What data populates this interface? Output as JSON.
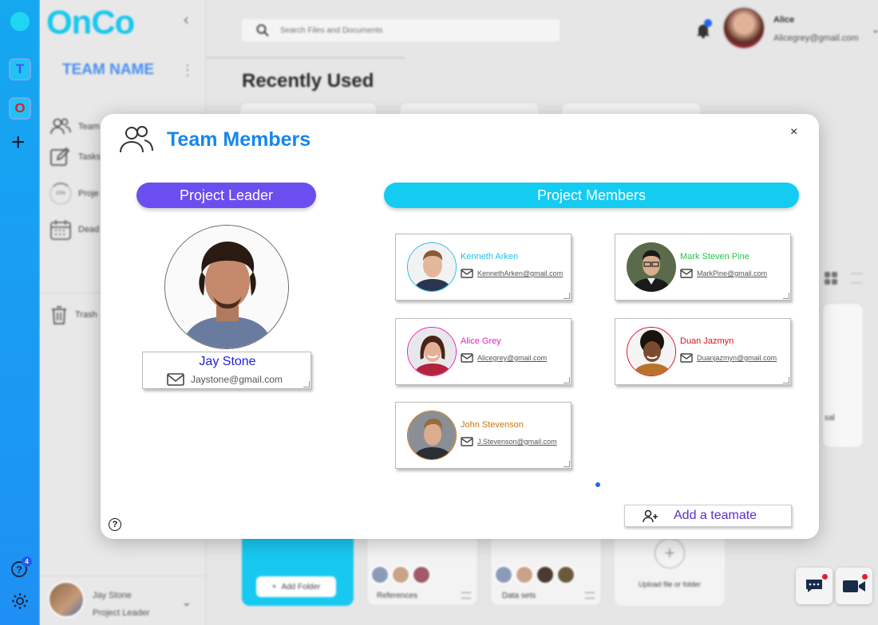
{
  "app": {
    "logo": "OnCo"
  },
  "rail": {
    "workspaces": [
      {
        "letter": "T"
      },
      {
        "letter": "O"
      }
    ],
    "help_badge": "4"
  },
  "sidebar": {
    "team_name": "TEAM NAME",
    "items": [
      {
        "label": "Team",
        "icon": "team-icon"
      },
      {
        "label": "Tasks",
        "icon": "edit-icon"
      },
      {
        "label": "Proje",
        "icon": "progress-icon"
      },
      {
        "label": "Dead",
        "icon": "calendar-icon"
      },
      {
        "label": "Trash",
        "icon": "trash-icon"
      }
    ],
    "progress_text": "20%",
    "user": {
      "name": "Jay Stone",
      "role": "Project Leader"
    }
  },
  "header": {
    "search_placeholder": "Search Files and Documents",
    "notification_count": "",
    "user": {
      "name": "Alice",
      "email": "Alicegrey@gmail.com"
    }
  },
  "main": {
    "title": "Recently Used",
    "folder_button": "Add Folder",
    "cards": [
      {
        "label": "References"
      },
      {
        "label": "Data sets"
      }
    ],
    "upload_label": "Upload file or folder",
    "partial_card_label": "sal"
  },
  "modal": {
    "title": "Team Members",
    "close_label": "×",
    "leader_section": "Project Leader",
    "members_section": "Project Members",
    "leader": {
      "name": "Jay Stone",
      "email": "Jaystone@gmail.com"
    },
    "members": [
      {
        "name": "Kenneth Arken",
        "email": "KennethArken@gmail.com",
        "color": "#1cbfe8"
      },
      {
        "name": "Mark Steven Pine",
        "email": "MarkPine@gmail.com",
        "color": "#2bc24a"
      },
      {
        "name": "Alice Grey",
        "email": "Alicegrey@gmail.com",
        "color": "#e81ec4"
      },
      {
        "name": "Duan Jazmyn",
        "email": "Duanjazmyn@gmail.com",
        "color": "#e0101f"
      },
      {
        "name": "John Stevenson",
        "email": "J.Stevenson@gmail.com",
        "color": "#c8780e"
      }
    ],
    "add_button": "Add a teamate",
    "help_label": "?"
  },
  "colors": {
    "accent_cyan": "#14cbf2",
    "accent_purple": "#6b4ef0",
    "title_blue": "#1586ee"
  }
}
